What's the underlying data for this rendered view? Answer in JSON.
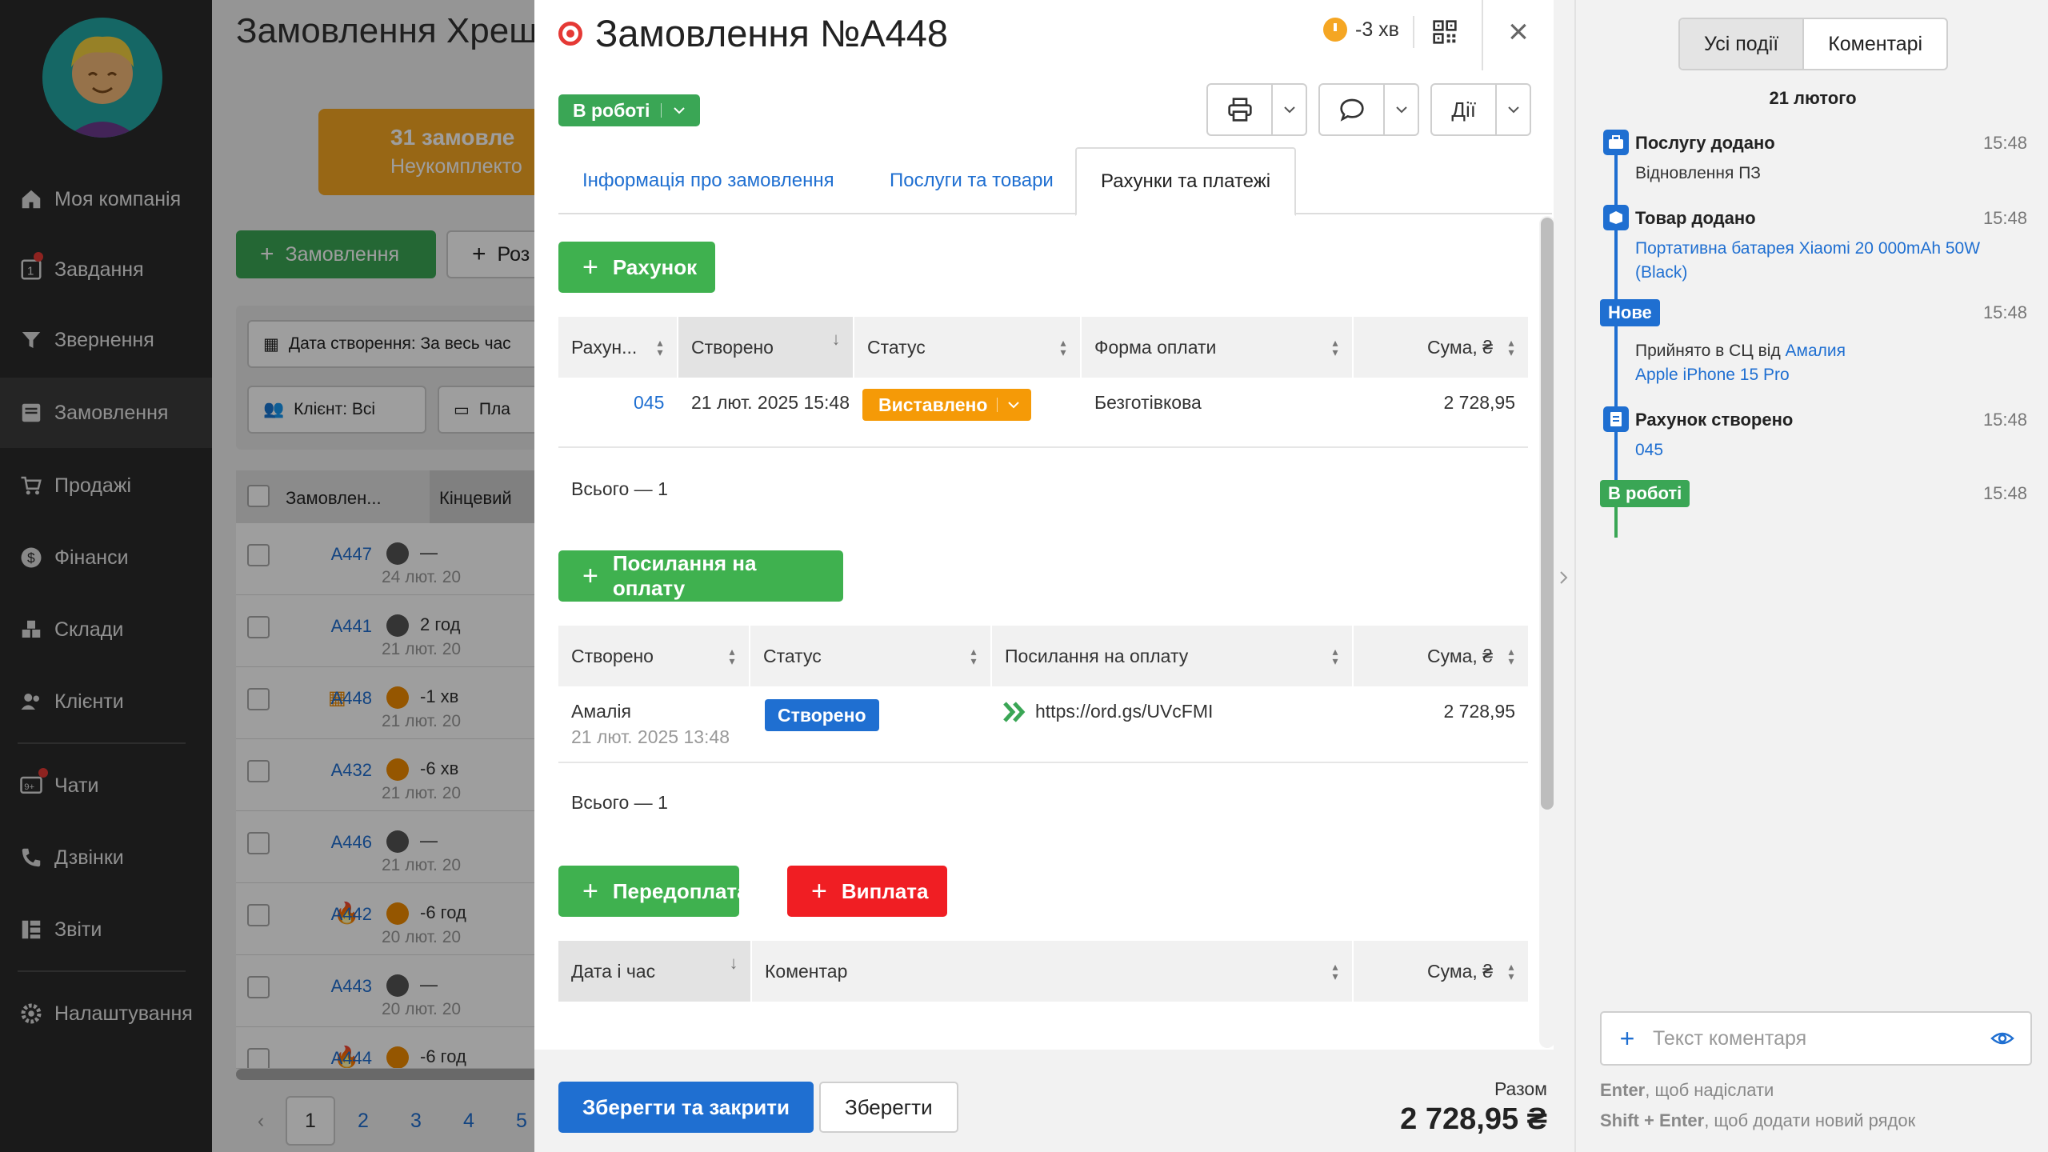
{
  "sidebar": {
    "items": [
      {
        "label": "Моя компанія",
        "icon": "home-icon"
      },
      {
        "label": "Завдання",
        "icon": "tasks-icon",
        "badge": "1"
      },
      {
        "label": "Звернення",
        "icon": "funnel-icon"
      },
      {
        "label": "Замовлення",
        "icon": "orders-icon"
      },
      {
        "label": "Продажі",
        "icon": "cart-icon"
      },
      {
        "label": "Фінанси",
        "icon": "dollar-icon"
      },
      {
        "label": "Склади",
        "icon": "boxes-icon"
      },
      {
        "label": "Клієнти",
        "icon": "users-icon"
      },
      {
        "label": "Чати",
        "icon": "chat-icon",
        "badge": "9+"
      },
      {
        "label": "Дзвінки",
        "icon": "phone-icon"
      },
      {
        "label": "Звіти",
        "icon": "reports-icon"
      },
      {
        "label": "Налаштування",
        "icon": "gear-icon"
      }
    ]
  },
  "background": {
    "title": "Замовлення Хреш",
    "orange_card": {
      "title": "31 замовле",
      "subtitle": "Неукомплекто"
    },
    "add_order_button": "Замовлення",
    "second_button": "Роз",
    "filter_date": "Дата створення: За весь час",
    "filter_client": "Клієнт: Всі",
    "filter_pay": "Пла",
    "table_headers": [
      "Замовлен...",
      "Кінцевий"
    ],
    "rows": [
      {
        "id": "A447",
        "time": "—",
        "date": "24 лют. 20"
      },
      {
        "id": "A441",
        "time": "2 год",
        "date": "21 лют. 20"
      },
      {
        "id": "A448",
        "time": "-1 хв",
        "date": "21 лют. 20"
      },
      {
        "id": "A432",
        "time": "-6 хв",
        "date": "21 лют. 20"
      },
      {
        "id": "A446",
        "time": "—",
        "date": "21 лют. 20"
      },
      {
        "id": "A442",
        "time": "-6 год",
        "date": "20 лют. 20"
      },
      {
        "id": "A443",
        "time": "—",
        "date": "20 лют. 20"
      },
      {
        "id": "A444",
        "time": "-6 год",
        "date": ""
      }
    ],
    "pagination": [
      "1",
      "2",
      "3",
      "4",
      "5"
    ]
  },
  "modal": {
    "title": "Замовлення №A448",
    "timer": "-3 хв",
    "status": "В роботі",
    "actions_label": "Дії",
    "tabs": [
      "Інформація про замовлення",
      "Послуги та товари",
      "Рахунки та платежі"
    ],
    "invoice_button": "Рахунок",
    "invoices": {
      "headers": [
        "Рахун...",
        "Створено",
        "Статус",
        "Форма оплати",
        "Сума, ₴"
      ],
      "rows": [
        {
          "number": "045",
          "created": "21 лют. 2025 15:48",
          "status": "Виставлено",
          "payment_form": "Безготівкова",
          "sum": "2 728,95"
        }
      ],
      "total": "Всього — 1"
    },
    "payment_link_button": "Посилання на оплату",
    "payment_links": {
      "headers": [
        "Створено",
        "Статус",
        "Посилання на оплату",
        "Сума, ₴"
      ],
      "rows": [
        {
          "author": "Амалія",
          "date": "21 лют. 2025 13:48",
          "status": "Створено",
          "url": "https://ord.gs/UVcFMI",
          "sum": "2 728,95"
        }
      ],
      "total": "Всього — 1"
    },
    "prepay_button": "Передоплата",
    "payout_button": "Виплата",
    "payments": {
      "headers": [
        "Дата і час",
        "Коментар",
        "Сума, ₴"
      ]
    },
    "footer": {
      "save_close": "Зберегти та закрити",
      "save": "Зберегти",
      "total_label": "Разом",
      "total_value": "2 728,95 ₴"
    }
  },
  "events_panel": {
    "tabs": [
      "Усі події",
      "Коментарі"
    ],
    "date": "21 лютого",
    "events": [
      {
        "title": "Послугу додано",
        "time": "15:48",
        "text": "Відновлення ПЗ"
      },
      {
        "title": "Товар додано",
        "time": "15:48",
        "link": "Портативна батарея Xiaomi 20 000mAh 50W (Black)"
      },
      {
        "badge": "Нове",
        "time": "15:48",
        "text": "Прийнято в СЦ від",
        "link_name": "Амалия",
        "link_device": "Apple iPhone 15 Pro"
      },
      {
        "title": "Рахунок створено",
        "time": "15:48",
        "link": "045"
      },
      {
        "badge": "В роботі",
        "time": "15:48"
      }
    ],
    "comment_placeholder": "Текст коментаря",
    "hint1_key": "Enter",
    "hint1_text": ", щоб надіслати",
    "hint2_key": "Shift + Enter",
    "hint2_text": ", щоб додати новий рядок"
  },
  "colors": {
    "green": "#3fb14f",
    "blue": "#1f6fd1",
    "orange": "#f59a07",
    "red": "#f01e23",
    "sidebar": "#2a2a2a"
  }
}
